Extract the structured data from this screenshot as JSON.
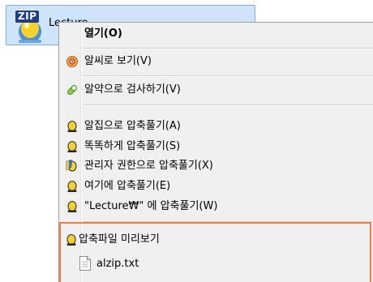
{
  "desktop": {
    "file": {
      "badge": "ZIP",
      "name": "Lecture"
    }
  },
  "context_menu": {
    "items": [
      {
        "label": "열기(O)",
        "icon": "none"
      },
      {
        "label": "알씨로 보기(V)",
        "icon": "alsee-icon"
      },
      {
        "label": "알약으로 검사하기(V)",
        "icon": "pill-icon"
      },
      {
        "label": "알집으로 압축풀기(A)",
        "icon": "alzip-egg-icon"
      },
      {
        "label": "똑똑하게 압축풀기(S)",
        "icon": "alzip-egg-icon"
      },
      {
        "label": "관리자 권한으로 압축풀기(X)",
        "icon": "admin-shield-icon"
      },
      {
        "label": "여기에 압축풀기(E)",
        "icon": "alzip-egg-icon"
      },
      {
        "label": "\"Lecture₩\" 에 압축풀기(W)",
        "icon": "alzip-egg-icon"
      },
      {
        "label": "압축파일 미리보기",
        "icon": "alzip-egg-icon"
      }
    ],
    "preview_file": "alzip.txt"
  },
  "colors": {
    "selection_bg": "#cfe3fa",
    "menu_bg": "#f0f0f0",
    "highlight_border": "#f07c4a",
    "zip_badge": "#1f3f84",
    "egg_yellow": "#f6d22a"
  }
}
